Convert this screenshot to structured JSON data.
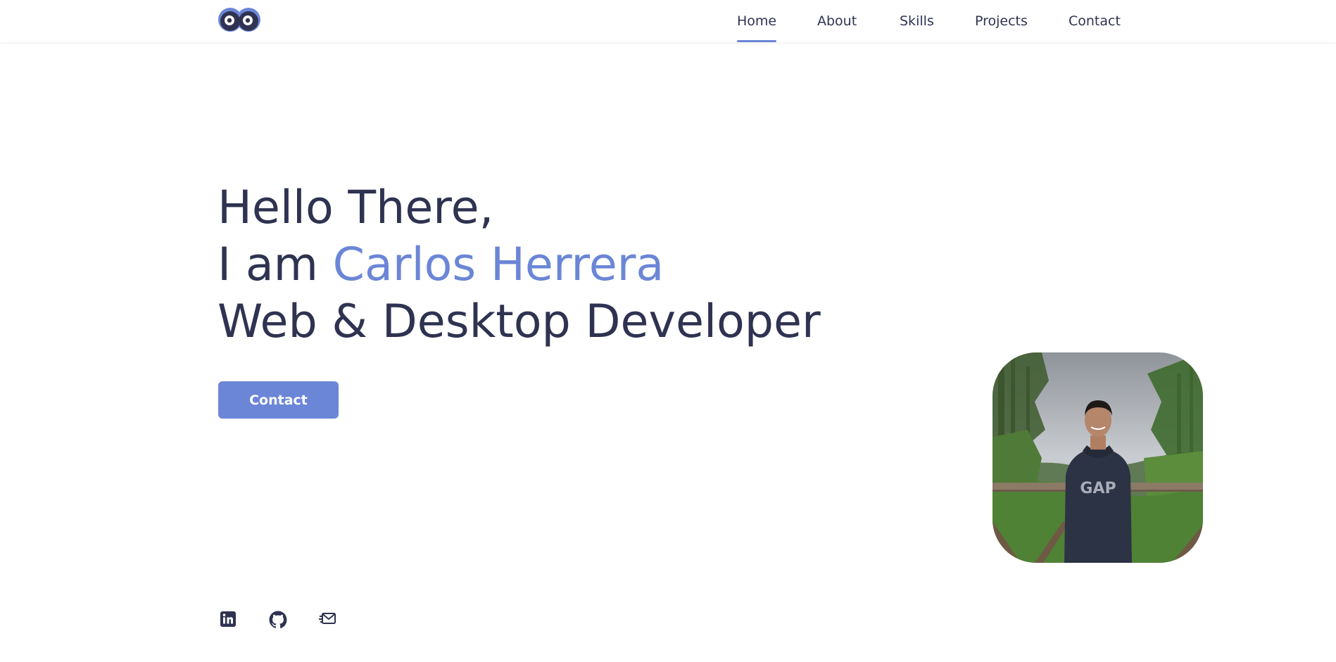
{
  "header": {
    "logo_icon": "owl-eyes-logo",
    "nav": [
      {
        "label": "Home",
        "active": true
      },
      {
        "label": "About",
        "active": false
      },
      {
        "label": "Skills",
        "active": false
      },
      {
        "label": "Projects",
        "active": false
      },
      {
        "label": "Contact",
        "active": false
      }
    ]
  },
  "hero": {
    "line1": "Hello There,",
    "line2_prefix": "I am ",
    "name": "Carlos Herrera",
    "line3": "Web & Desktop Developer",
    "button_label": "Contact",
    "photo_icon": "profile-photo"
  },
  "social": [
    {
      "icon": "linkedin-icon"
    },
    {
      "icon": "github-icon"
    },
    {
      "icon": "email-icon"
    }
  ],
  "colors": {
    "accent": "#6b86d6",
    "text": "#2f3351",
    "background": "#ffffff"
  }
}
